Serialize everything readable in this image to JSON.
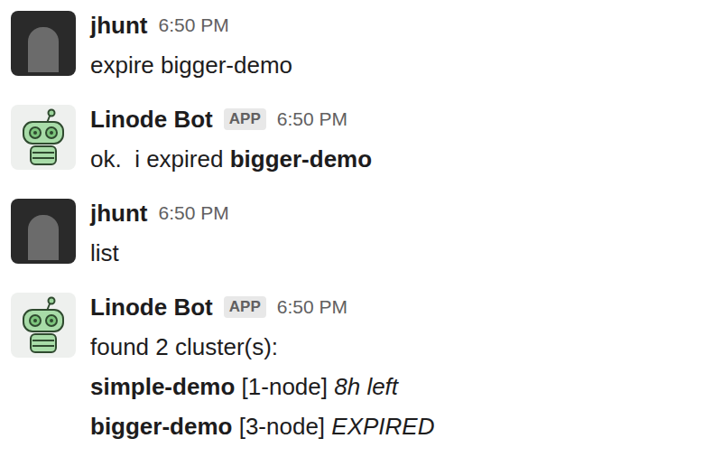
{
  "messages": [
    {
      "author": "jhunt",
      "time": "6:50 PM",
      "kind": "user",
      "badge": null,
      "lines": [
        [
          {
            "text": "expire bigger-demo",
            "style": "normal"
          }
        ]
      ]
    },
    {
      "author": "Linode Bot",
      "time": "6:50 PM",
      "kind": "bot",
      "badge": "APP",
      "lines": [
        [
          {
            "text": "ok.  i expired ",
            "style": "normal"
          },
          {
            "text": "bigger-demo",
            "style": "bold"
          }
        ]
      ]
    },
    {
      "author": "jhunt",
      "time": "6:50 PM",
      "kind": "user",
      "badge": null,
      "lines": [
        [
          {
            "text": "list",
            "style": "normal"
          }
        ]
      ]
    },
    {
      "author": "Linode Bot",
      "time": "6:50 PM",
      "kind": "bot",
      "badge": "APP",
      "lines": [
        [
          {
            "text": "found 2 cluster(s):",
            "style": "normal"
          }
        ],
        [
          {
            "text": "simple-demo",
            "style": "bold"
          },
          {
            "text": " [1-node] ",
            "style": "normal"
          },
          {
            "text": "8h left",
            "style": "italic"
          }
        ],
        [
          {
            "text": "bigger-demo",
            "style": "bold"
          },
          {
            "text": " [3-node] ",
            "style": "normal"
          },
          {
            "text": "EXPIRED",
            "style": "italic"
          }
        ]
      ]
    }
  ]
}
